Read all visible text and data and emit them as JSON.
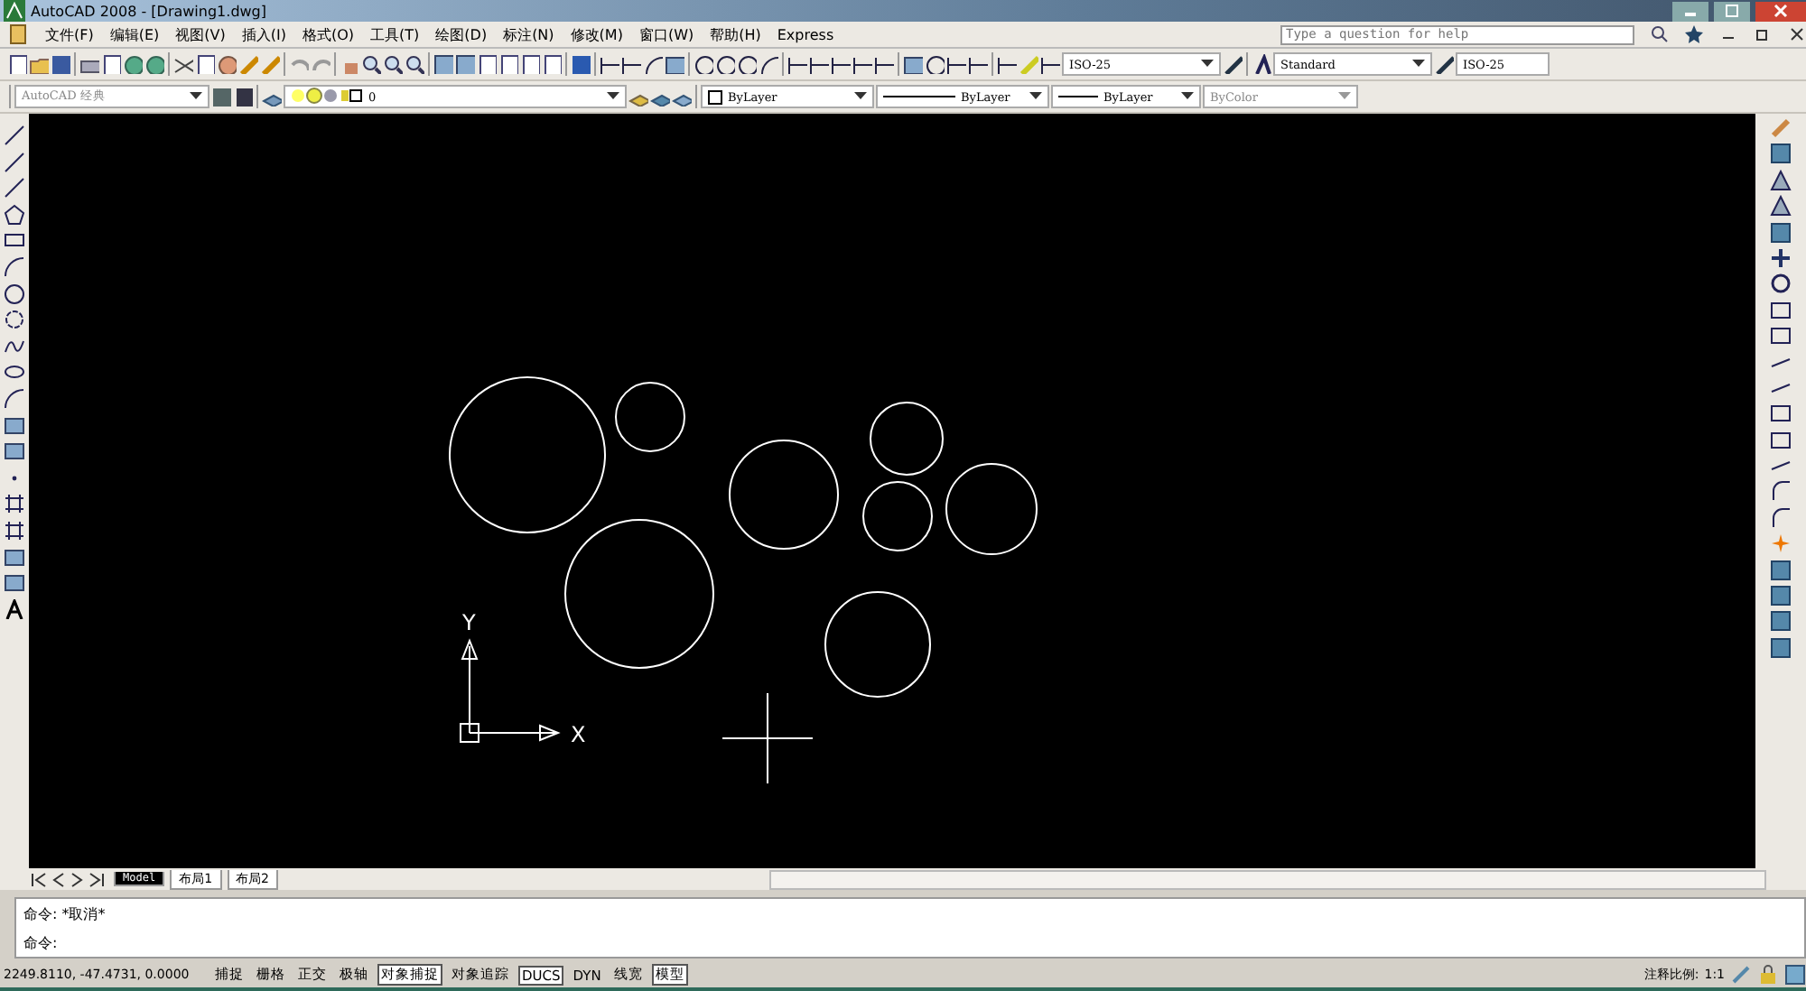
{
  "window": {
    "title": "AutoCAD 2008 - [Drawing1.dwg]"
  },
  "menu": [
    "文件(F)",
    "编辑(E)",
    "视图(V)",
    "插入(I)",
    "格式(O)",
    "工具(T)",
    "绘图(D)",
    "标注(N)",
    "修改(M)",
    "窗口(W)",
    "帮助(H)",
    "Express"
  ],
  "help_search": {
    "placeholder": "Type a question for help"
  },
  "styles_toolbar": {
    "dimension_style": "ISO-25",
    "text_style": "Standard",
    "table_style": "ISO-25"
  },
  "workspace": {
    "value": "AutoCAD 经典"
  },
  "layer": {
    "value": "0"
  },
  "properties": {
    "color_setting": "ByLayer",
    "linetype": "ByLayer",
    "lineweight": "ByLayer",
    "plot_style": "ByColor"
  },
  "canvas": {
    "ucs_y": "Y",
    "ucs_x": "X"
  },
  "layout_tabs": [
    {
      "label": "Model",
      "selected": true
    },
    {
      "label": "布局1",
      "selected": false
    },
    {
      "label": "布局2",
      "selected": false
    }
  ],
  "command_lines": [
    "命令: *取消*",
    "命令:"
  ],
  "status_bar": {
    "coordinates": "2249.8110, -47.4731, 0.0000",
    "toggles": [
      {
        "label": "捕捉",
        "on": false
      },
      {
        "label": "栅格",
        "on": false
      },
      {
        "label": "正交",
        "on": false
      },
      {
        "label": "极轴",
        "on": false
      },
      {
        "label": "对象捕捉",
        "on": true
      },
      {
        "label": "对象追踪",
        "on": false
      },
      {
        "label": "DUCS",
        "on": true
      },
      {
        "label": "DYN",
        "on": false
      },
      {
        "label": "线宽",
        "on": false
      },
      {
        "label": "模型",
        "on": true
      }
    ],
    "annotation_scale_label": "注释比例:",
    "annotation_scale": "1:1"
  }
}
